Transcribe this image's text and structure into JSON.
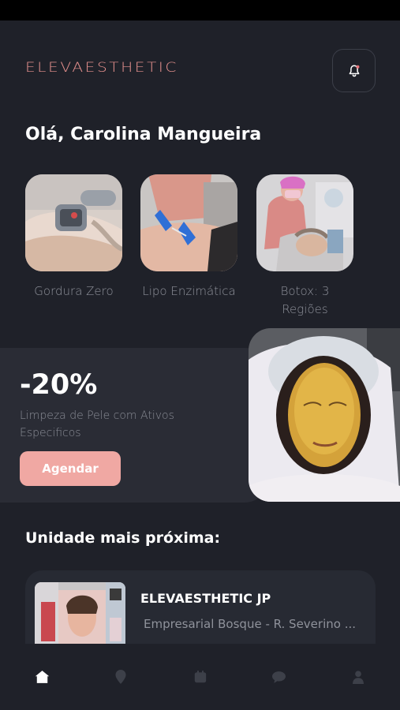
{
  "app": {
    "logo": "ELEVAESTHETIC"
  },
  "header": {
    "greeting": "Olá, Carolina Mangueira"
  },
  "services": [
    {
      "label": "Gordura Zero",
      "icon": "device-treatment-photo"
    },
    {
      "label": "Lipo Enzimática",
      "icon": "injection-treatment-photo"
    },
    {
      "label": "Botox: 3 Regiões",
      "icon": "botox-treatment-photo"
    }
  ],
  "promo": {
    "discount": "-20%",
    "description": "Limpeza de Pele com Ativos Especificos",
    "button_label": "Agendar"
  },
  "nearest": {
    "title": "Unidade mais próxima:",
    "unit_name": "ELEVAESTHETIC JP",
    "address": "Empresarial Bosque - R. Severino ..."
  },
  "nav": {
    "items": [
      "home-icon",
      "location-pin-icon",
      "calendar-icon",
      "chat-icon",
      "profile-icon"
    ],
    "active": "home-icon"
  },
  "colors": {
    "background": "#1f2129",
    "card": "#2a2c35",
    "accent": "#f0a8a3",
    "logo": "#e8928f",
    "muted_text": "#8f929b"
  }
}
